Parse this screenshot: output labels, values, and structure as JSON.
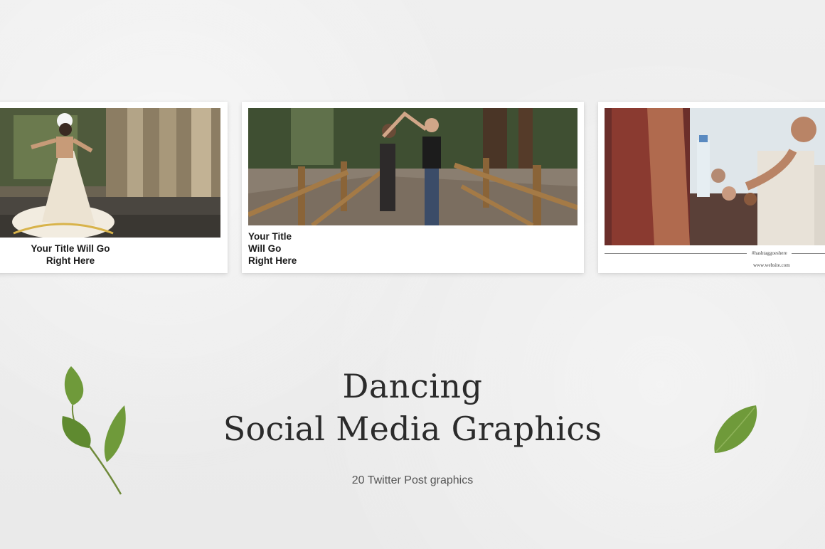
{
  "cards": [
    {
      "title_line1": "Your Title Will Go",
      "title_line2": "Right Here"
    },
    {
      "title_line1": "Your Title",
      "title_line2": "Will Go",
      "title_line3": "Right Here"
    },
    {
      "hashtag": "#hashtaggoeshere",
      "website": "www.website.com"
    }
  ],
  "headline": {
    "line1": "Dancing",
    "line2": "Social Media Graphics"
  },
  "subtitle": "20 Twitter Post graphics",
  "colors": {
    "background": "#ededed",
    "card": "#ffffff",
    "text": "#2b2b2b"
  }
}
